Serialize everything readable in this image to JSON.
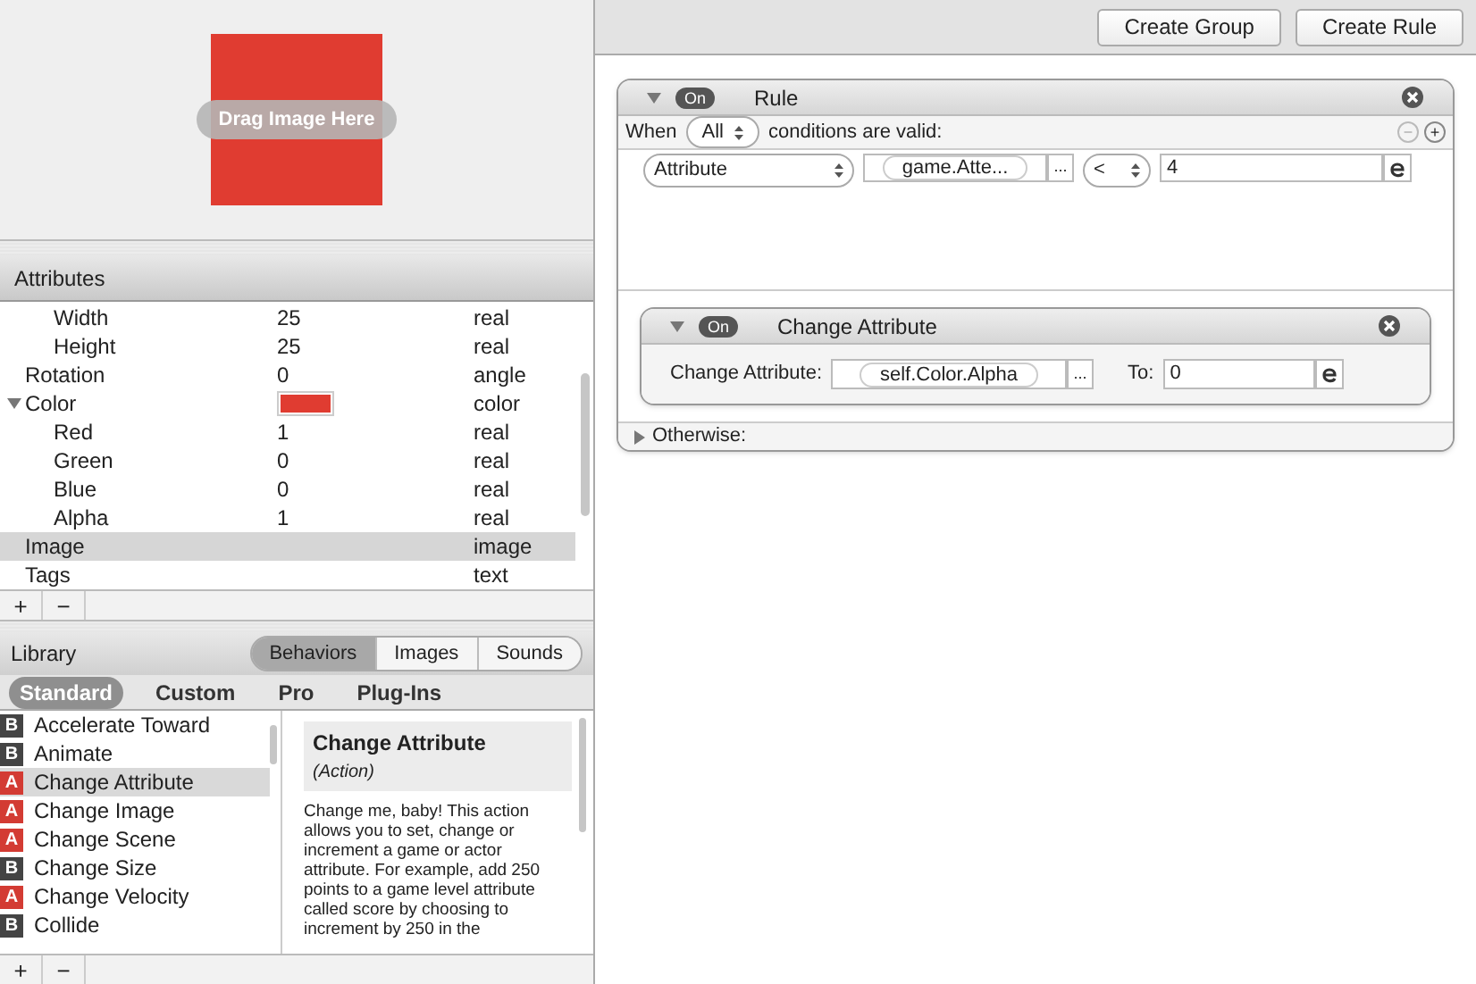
{
  "preview": {
    "drop_label": "Drag Image Here"
  },
  "attributes": {
    "title": "Attributes",
    "rows": [
      {
        "children": [
          {
            "name": "Width",
            "value": "25",
            "type": "real",
            "selected": false
          },
          {
            "name": "Height",
            "value": "25",
            "type": "real",
            "selected": false
          }
        ]
      },
      {
        "name": "Rotation",
        "value": "0",
        "type": "angle",
        "selected": false
      },
      {
        "name": "Color",
        "color": "#e03c31",
        "type": "color",
        "selected": false,
        "expanded": true,
        "children": [
          {
            "name": "Red",
            "value": "1",
            "type": "real",
            "selected": false
          },
          {
            "name": "Green",
            "value": "0",
            "type": "real",
            "selected": false
          },
          {
            "name": "Blue",
            "value": "0",
            "type": "real",
            "selected": false
          },
          {
            "name": "Alpha",
            "value": "1",
            "type": "real",
            "selected": false
          }
        ]
      },
      {
        "name": "Image",
        "type": "image",
        "selected": true
      },
      {
        "name": "Tags",
        "type": "text",
        "selected": false
      }
    ],
    "buttons": [
      "+",
      "−"
    ]
  },
  "library": {
    "title": "Library",
    "tabs": [
      {
        "label": "Behaviors",
        "selected": true
      },
      {
        "label": "Images",
        "selected": false
      },
      {
        "label": "Sounds",
        "selected": false
      }
    ],
    "categories": [
      {
        "label": "Standard",
        "selected": true
      },
      {
        "label": "Custom",
        "selected": false
      },
      {
        "label": "Pro",
        "selected": false
      },
      {
        "label": "Plug-Ins",
        "selected": false
      }
    ],
    "items": [
      {
        "badge": "B",
        "kind": "behavior",
        "label": "Accelerate Toward",
        "selected": false
      },
      {
        "badge": "B",
        "kind": "behavior",
        "label": "Animate",
        "selected": false
      },
      {
        "badge": "A",
        "kind": "action",
        "label": "Change Attribute",
        "selected": true
      },
      {
        "badge": "A",
        "kind": "action",
        "label": "Change Image",
        "selected": false
      },
      {
        "badge": "A",
        "kind": "action",
        "label": "Change Scene",
        "selected": false
      },
      {
        "badge": "B",
        "kind": "behavior",
        "label": "Change Size",
        "selected": false
      },
      {
        "badge": "A",
        "kind": "action",
        "label": "Change Velocity",
        "selected": false
      },
      {
        "badge": "B",
        "kind": "behavior",
        "label": "Collide",
        "selected": false
      }
    ],
    "detail": {
      "title": "Change Attribute",
      "subtitle": "(Action)",
      "text": "Change me, baby! This action allows you to set, change or increment a game or actor attribute. For example, add 250 points to a game level attribute called score by choosing to increment by 250 in the"
    },
    "buttons": [
      "+",
      "−"
    ]
  },
  "toolbar": {
    "buttons": [
      "Create Group",
      "Create Rule"
    ]
  },
  "rule": {
    "on_label": "On",
    "expanded": true,
    "title": "Rule",
    "when_label": "When",
    "match": "All",
    "conditions_label": "conditions are valid:",
    "condition_buttons": [
      "−",
      "+"
    ],
    "condition": {
      "attribute": "Attribute",
      "path": "game.Atte...",
      "browse": "...",
      "operator": "<",
      "value": "4"
    },
    "action": {
      "on_label": "On",
      "expanded": true,
      "title": "Change Attribute",
      "field_label": "Change Attribute:",
      "path": "self.Color.Alpha",
      "browse": "...",
      "to_label": "To:",
      "value": "0"
    },
    "otherwise": {
      "label": "Otherwise:",
      "expanded": false
    }
  }
}
